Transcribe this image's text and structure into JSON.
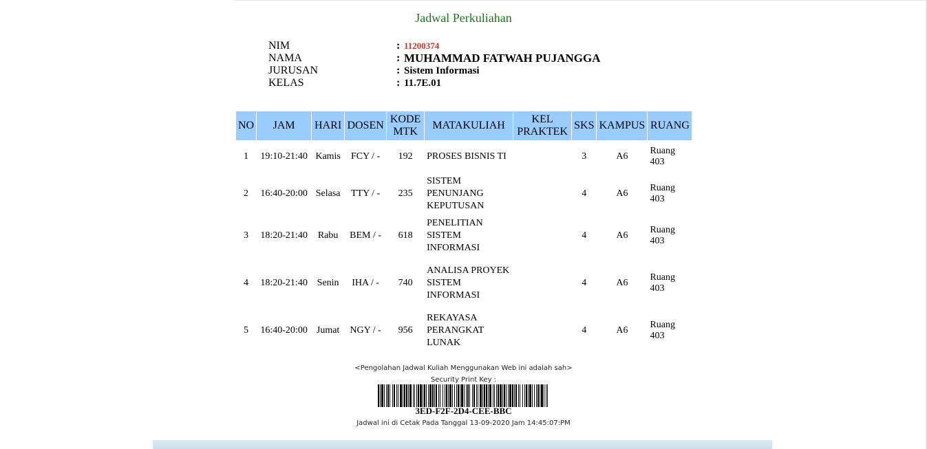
{
  "page": {
    "title": "Jadwal Perkuliahan"
  },
  "student": {
    "nim_label": "NIM",
    "nim": "11200374",
    "nama_label": "NAMA",
    "nama": "MUHAMMAD FATWAH PUJANGGA",
    "jurusan_label": "JURUSAN",
    "jurusan": "Sistem Informasi",
    "kelas_label": "KELAS",
    "kelas": "11.7E.01",
    "colon": ":"
  },
  "table": {
    "headers": {
      "no": "NO",
      "jam": "JAM",
      "hari": "HARI",
      "dosen": "DOSEN",
      "kode_1": "KODE",
      "kode_2": "MTK",
      "matakuliah": "MATAKULIAH",
      "kel_1": "KEL",
      "kel_2": "PRAKTEK",
      "sks": "SKS",
      "kampus": "KAMPUS",
      "ruang": "RUANG"
    },
    "rows": [
      {
        "no": "1",
        "jam": "19:10-21:40",
        "hari": "Kamis",
        "dosen": "FCY / -",
        "kode": "192",
        "matakuliah": "PROSES BISNIS TI",
        "kel": "",
        "sks": "3",
        "kampus": "A6",
        "ruang": "Ruang 403"
      },
      {
        "no": "2",
        "jam": "16:40-20:00",
        "hari": "Selasa",
        "dosen": "TTY / -",
        "kode": "235",
        "matakuliah": "SISTEM PENUNJANG KEPUTUSAN",
        "kel": "",
        "sks": "4",
        "kampus": "A6",
        "ruang": "Ruang 403"
      },
      {
        "no": "3",
        "jam": "18:20-21:40",
        "hari": "Rabu",
        "dosen": "BEM / -",
        "kode": "618",
        "matakuliah": "PENELITIAN SISTEM INFORMASI",
        "kel": "",
        "sks": "4",
        "kampus": "A6",
        "ruang": "Ruang 403"
      },
      {
        "no": "4",
        "jam": "18:20-21:40",
        "hari": "Senin",
        "dosen": "IHA / -",
        "kode": "740",
        "matakuliah": "ANALISA PROYEK SISTEM INFORMASI",
        "kel": "",
        "sks": "4",
        "kampus": "A6",
        "ruang": "Ruang 403"
      },
      {
        "no": "5",
        "jam": "16:40-20:00",
        "hari": "Jumat",
        "dosen": "NGY / -",
        "kode": "956",
        "matakuliah": "REKAYASA PERANGKAT LUNAK",
        "kel": "",
        "sks": "4",
        "kampus": "A6",
        "ruang": "Ruang 403"
      }
    ]
  },
  "footer": {
    "note": "<Pengolahan Jadwal Kuliah Menggunakan Web ini adalah sah>",
    "security_label": "Security Print Key :",
    "security_key": "3ED-F2F-2D4-CEE-BBC",
    "printed": "Jadwal ini di Cetak Pada Tanggal 13-09-2020 Jam 14:45:07:PM"
  },
  "colors": {
    "header_bg": "#99ccff",
    "title": "#1a7a1a",
    "nim": "#c0392b"
  }
}
